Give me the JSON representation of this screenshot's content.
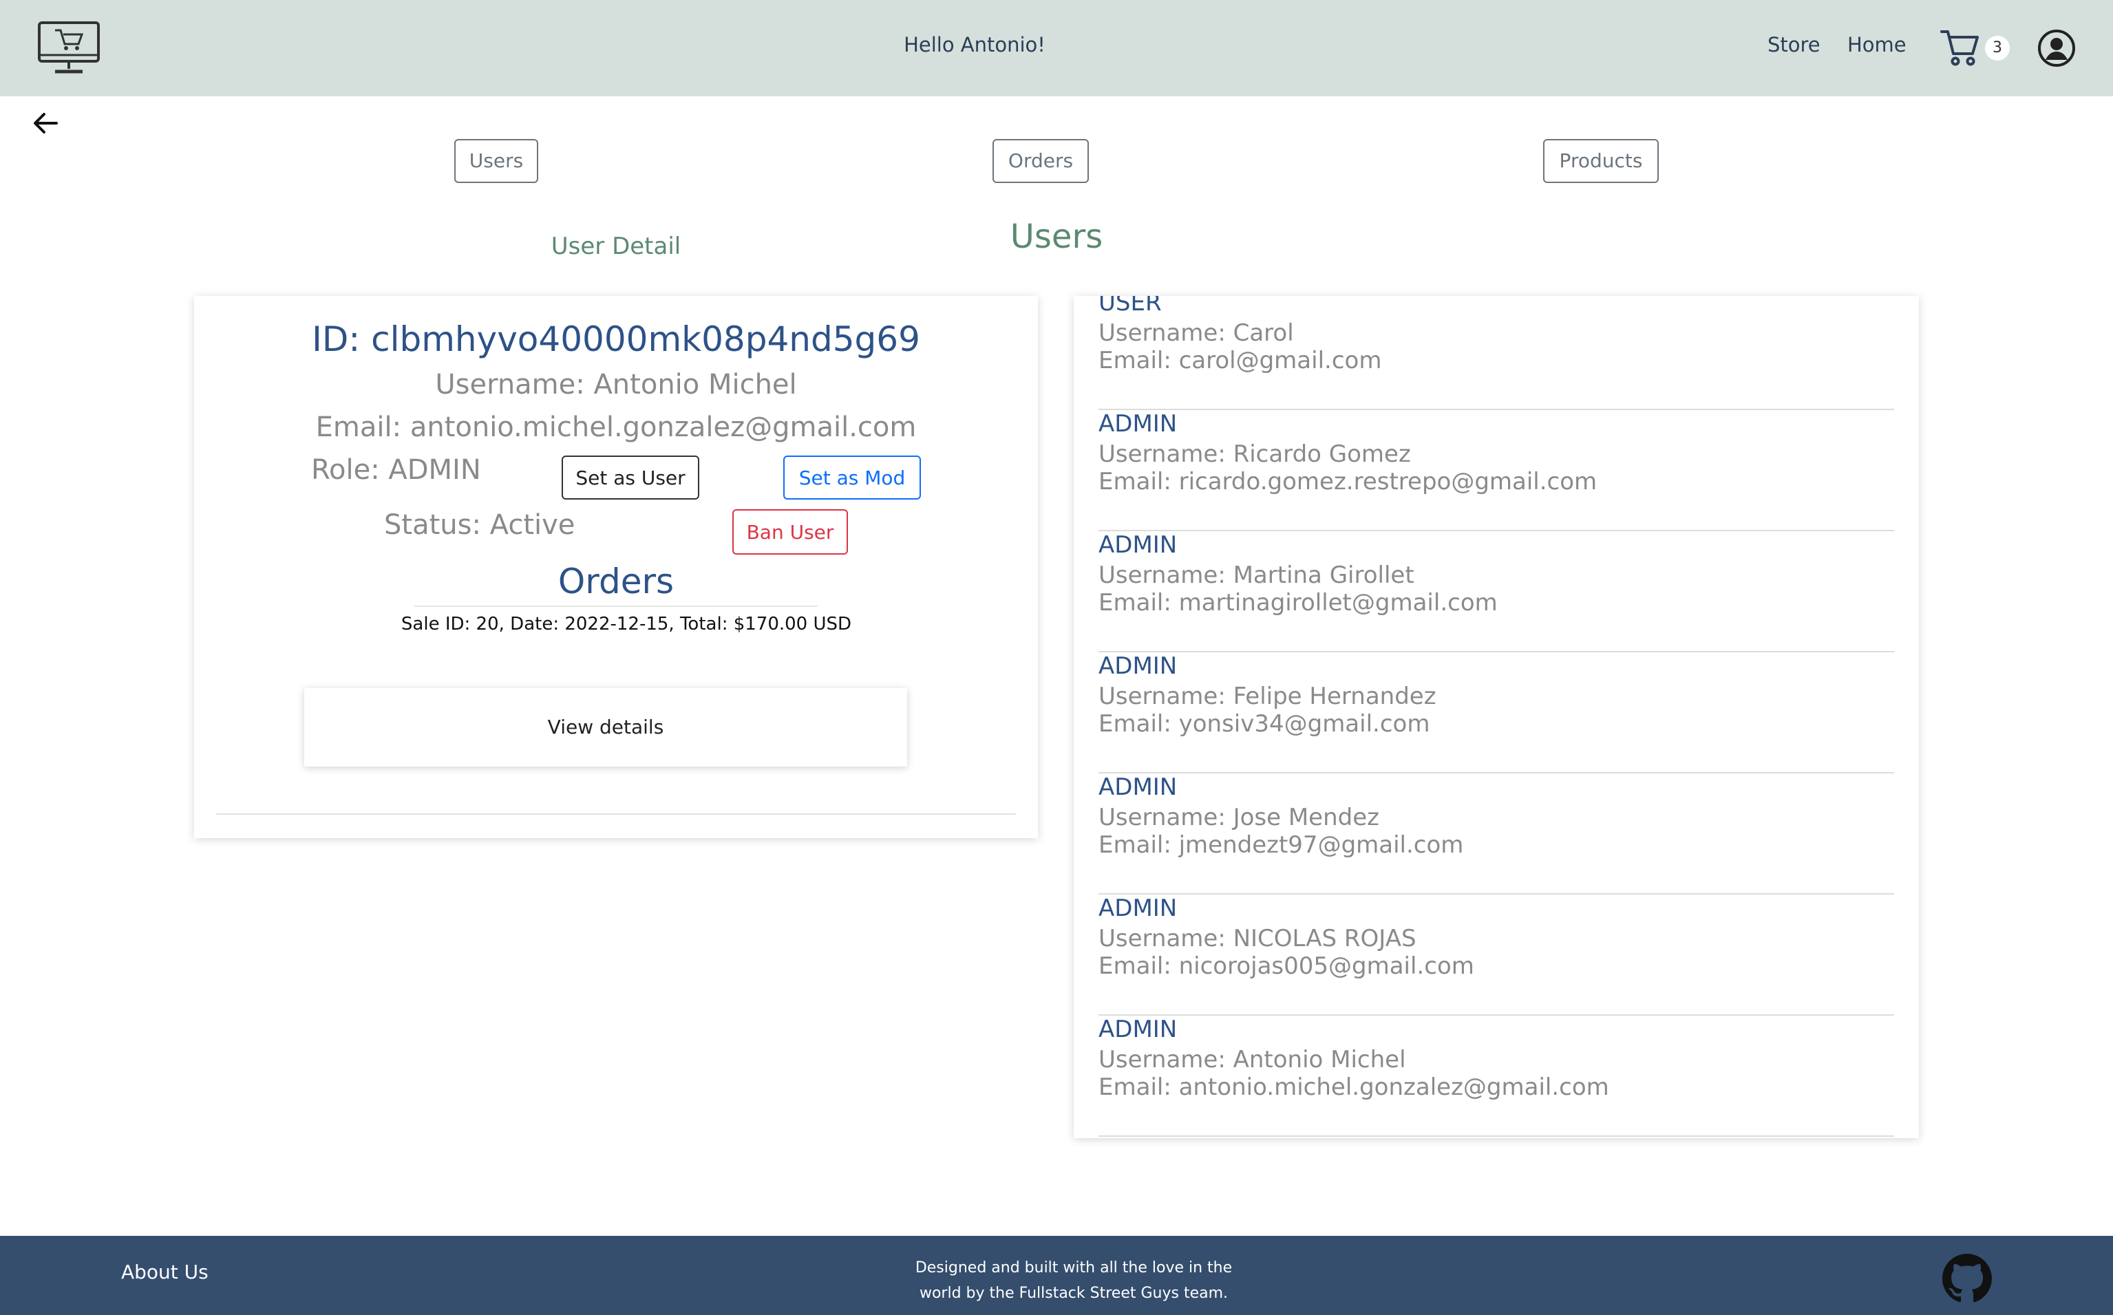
{
  "header": {
    "greeting": "Hello Antonio!",
    "nav": {
      "store": "Store",
      "home": "Home"
    },
    "cart_count": "3",
    "icons": {
      "logo": "computer-cart-logo",
      "cart": "cart-icon",
      "user": "user-circle-icon"
    }
  },
  "tabs": {
    "users": "Users",
    "orders": "Orders",
    "products": "Products"
  },
  "detail": {
    "section_title": "User Detail",
    "id": "ID: clbmhyvo40000mk08p4nd5g69",
    "username": "Username: Antonio Michel",
    "email": "Email: antonio.michel.gonzalez@gmail.com",
    "role": "Role: ADMIN",
    "status": "Status: Active",
    "buttons": {
      "set_user": "Set as User",
      "set_mod": "Set as Mod",
      "ban": "Ban User"
    },
    "orders_title": "Orders",
    "sale": "Sale ID: 20, Date: 2022-12-15, Total: $170.00 USD",
    "view_details": "View details"
  },
  "users": {
    "title": "Users",
    "list": [
      {
        "role": "USER",
        "username": "Username: Carol",
        "email": "Email: carol@gmail.com"
      },
      {
        "role": "ADMIN",
        "username": "Username: Ricardo Gomez",
        "email": "Email: ricardo.gomez.restrepo@gmail.com"
      },
      {
        "role": "ADMIN",
        "username": "Username: Martina Girollet",
        "email": "Email: martinagirollet@gmail.com"
      },
      {
        "role": "ADMIN",
        "username": "Username: Felipe Hernandez",
        "email": "Email: yonsiv34@gmail.com"
      },
      {
        "role": "ADMIN",
        "username": "Username: Jose Mendez",
        "email": "Email: jmendezt97@gmail.com"
      },
      {
        "role": "ADMIN",
        "username": "Username: NICOLAS ROJAS",
        "email": "Email: nicorojas005@gmail.com"
      },
      {
        "role": "ADMIN",
        "username": "Username: Antonio Michel",
        "email": "Email: antonio.michel.gonzalez@gmail.com"
      }
    ]
  },
  "footer": {
    "about": "About Us",
    "credits_line1": "Designed and built with all the love in the",
    "credits_line2": "world by the Fullstack Street Guys team.",
    "icon": "github-icon"
  },
  "colors": {
    "header_bg": "#d5e0dc",
    "footer_bg": "#354e6e",
    "accent_green": "#5b8a70",
    "heading_blue": "#2d5288",
    "mod_blue": "#0d6efd",
    "ban_red": "#dc3545"
  }
}
